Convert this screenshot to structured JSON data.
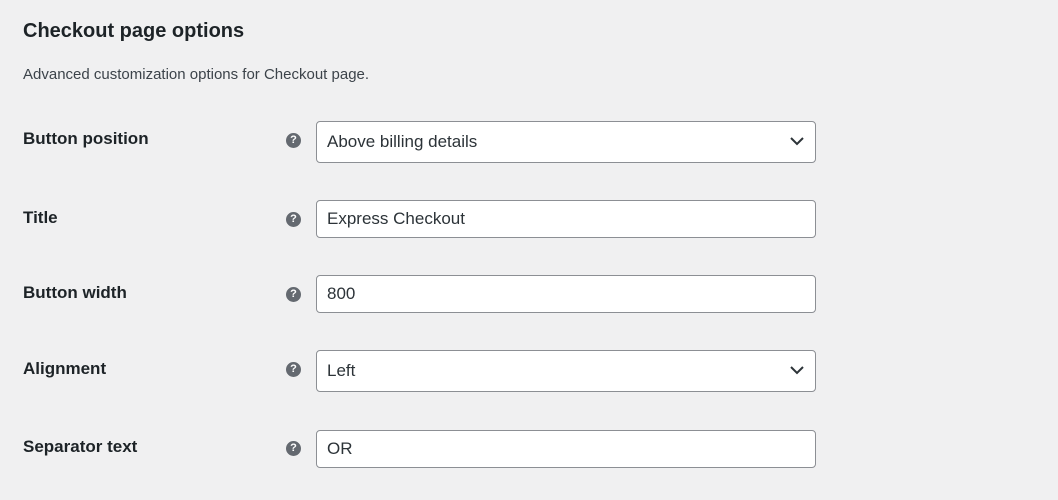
{
  "section": {
    "title": "Checkout page options",
    "description": "Advanced customization options for Checkout page."
  },
  "fields": {
    "button_position": {
      "label": "Button position",
      "value": "Above billing details",
      "help_icon": "help-icon"
    },
    "title": {
      "label": "Title",
      "value": "Express Checkout",
      "help_icon": "help-icon"
    },
    "button_width": {
      "label": "Button width",
      "value": "800",
      "help_icon": "help-icon"
    },
    "alignment": {
      "label": "Alignment",
      "value": "Left",
      "help_icon": "help-icon"
    },
    "separator_text": {
      "label": "Separator text",
      "value": "OR",
      "help_icon": "help-icon"
    }
  },
  "help_glyph": "?",
  "colors": {
    "background": "#f0f0f1",
    "field_border": "#8c8f94",
    "help_icon": "#646970",
    "text": "#1d2327"
  }
}
